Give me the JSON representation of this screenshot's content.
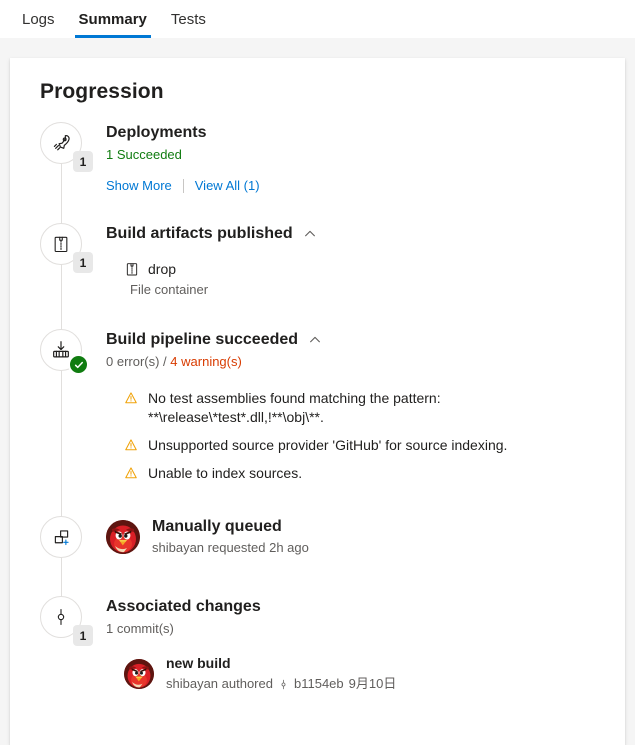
{
  "tabs": [
    {
      "label": "Logs",
      "active": false
    },
    {
      "label": "Summary",
      "active": true
    },
    {
      "label": "Tests",
      "active": false
    }
  ],
  "page": {
    "title": "Progression"
  },
  "colors": {
    "accent": "#0078d4",
    "success": "#107c10",
    "warning": "#d83b01",
    "badge_bg": "#e8e8e8",
    "card_bg": "#ffffff",
    "page_bg": "#f5f5f5"
  },
  "timeline": {
    "deployments": {
      "icon": "rocket-icon",
      "badge": "1",
      "title": "Deployments",
      "status": "1 Succeeded",
      "show_more_label": "Show More",
      "view_all_label": "View All (1)"
    },
    "artifacts": {
      "icon": "zip-package-icon",
      "badge": "1",
      "title": "Build artifacts published",
      "collapse_icon": "chevron-up-icon",
      "items": [
        {
          "name": "drop",
          "type": "File container",
          "icon": "zip-package-icon"
        }
      ]
    },
    "build": {
      "icon": "build-pipeline-icon",
      "status_icon": "check-circle-icon",
      "title": "Build pipeline succeeded",
      "collapse_icon": "chevron-up-icon",
      "errors_text": "0 error(s) / ",
      "warnings_text": "4 warning(s)",
      "warnings": [
        "No test assemblies found matching the pattern: **\\release\\*test*.dll,!**\\obj\\**.",
        "Unsupported source provider 'GitHub' for source indexing.",
        "Unable to index sources."
      ]
    },
    "queued": {
      "icon": "queue-add-icon",
      "avatar": "user-avatar",
      "title": "Manually queued",
      "subtitle": "shibayan requested 2h ago"
    },
    "changes": {
      "icon": "commit-icon",
      "badge": "1",
      "title": "Associated changes",
      "subtitle": "1 commit(s)",
      "commits": [
        {
          "message": "new build",
          "author_text": "shibayan authored",
          "commit_glyph": "commit-icon",
          "hash": "b1154eb",
          "date": "9月10日"
        }
      ]
    }
  }
}
